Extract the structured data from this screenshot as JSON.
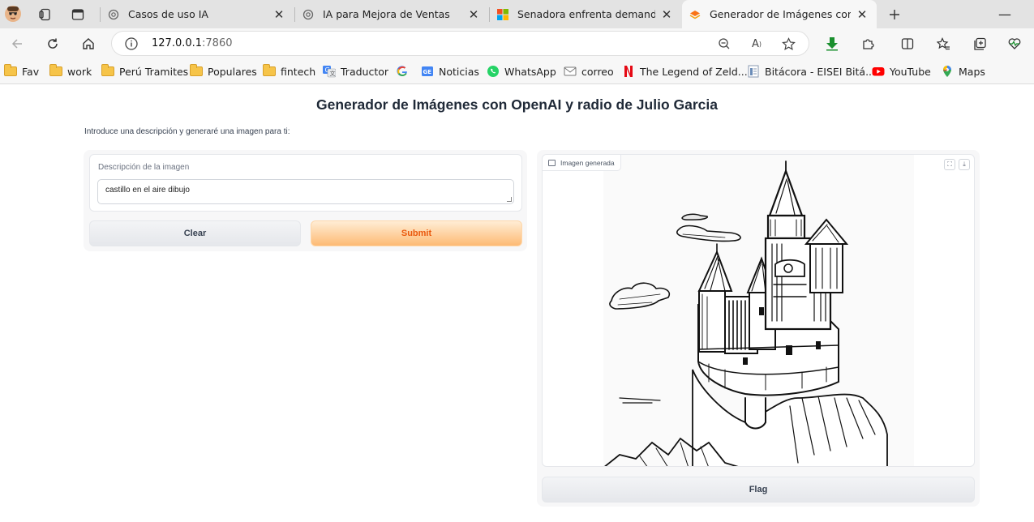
{
  "browser": {
    "tabs": [
      {
        "title": "Casos de uso IA",
        "icon": "openai-icon"
      },
      {
        "title": "IA para Mejora de Ventas",
        "icon": "openai-icon"
      },
      {
        "title": "Senadora enfrenta demanda por ",
        "icon": "microsoft-icon"
      },
      {
        "title": "Generador de Imágenes con Ope",
        "icon": "gradio-icon",
        "active": true
      }
    ],
    "url_host": "127.0.0.1",
    "url_port": ":7860",
    "bookmarks": [
      {
        "label": "Fav",
        "icon": "folder-icon"
      },
      {
        "label": "work",
        "icon": "folder-icon"
      },
      {
        "label": "Perú Tramites",
        "icon": "folder-icon"
      },
      {
        "label": "Populares",
        "icon": "folder-icon"
      },
      {
        "label": "fintech",
        "icon": "folder-icon"
      },
      {
        "label": "Traductor",
        "icon": "translate-icon"
      },
      {
        "label": "",
        "icon": "google-icon"
      },
      {
        "label": "Noticias",
        "icon": "google-news-icon"
      },
      {
        "label": "WhatsApp",
        "icon": "whatsapp-icon"
      },
      {
        "label": "correo",
        "icon": "mail-icon"
      },
      {
        "label": "The Legend of Zeld...",
        "icon": "netflix-icon"
      },
      {
        "label": "Bitácora - EISEI Bitá...",
        "icon": "doc-icon"
      },
      {
        "label": "YouTube",
        "icon": "youtube-icon"
      },
      {
        "label": "Maps",
        "icon": "maps-icon"
      }
    ]
  },
  "app": {
    "title": "Generador de Imágenes con OpenAI y radio de Julio Garcia",
    "intro": "Introduce una descripción y generaré una imagen para ti:",
    "input": {
      "label": "Descripción de la imagen",
      "value": "castillo en el aire dibujo"
    },
    "clear_label": "Clear",
    "submit_label": "Submit",
    "output_label": "Imagen generada",
    "flag_label": "Flag"
  },
  "colors": {
    "submit_text": "#ea580c",
    "submit_bg": "#fdba74",
    "download_green": "#1a8f2e"
  }
}
